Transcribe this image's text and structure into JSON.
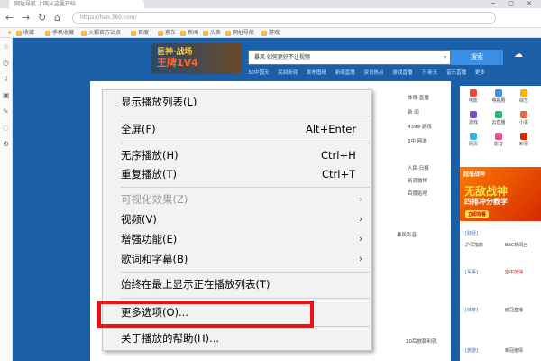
{
  "browser": {
    "tab_title": "网址导航 上网从这里开始",
    "url": "https://hao.360.com/",
    "bookmarks": [
      "收藏",
      "手机收藏",
      "火狐官方站点",
      "百度",
      "京东",
      "新闻",
      "头条",
      "网址导航",
      "游戏"
    ],
    "nav_buttons": [
      "←",
      "→",
      "↻",
      "⌂"
    ],
    "window_controls": "─ □ ✕"
  },
  "page": {
    "game_banner_line1": "巨神·战场",
    "game_banner_line2": "王牌1V4",
    "search_text": "暴风 如何更好不让视频",
    "search_button": "搜索",
    "hot_links": [
      "30中国天",
      "民间新闻",
      "发布图纸",
      "新闻直播",
      "资讯热点",
      "游戏直播",
      "下 新天",
      "音乐直播",
      "更多"
    ],
    "content_links_right": [
      "体育·直播",
      "新 闻",
      "4399·游戏",
      "3中 网游",
      "人民·日报",
      "新浪微博",
      "百度贴吧"
    ],
    "content_mid": "暴风影音",
    "content_bottom": "10后放款利就",
    "side_icons": [
      "电影",
      "电视剧",
      "综艺",
      "游戏",
      "云直播",
      "小说",
      "网页",
      "影音",
      "彩票"
    ],
    "ad_top": "超低战神",
    "ad_title": "无敌战神",
    "ad_sub": "四排冲分教学",
    "ad_btn": "立即观看",
    "right_list": [
      "[财经]",
      "沪深指数",
      "BBC新闻台",
      "[军事]",
      "空中加油",
      "[体育]",
      "欧冠直播",
      "[旅游]",
      "新冠疫情"
    ]
  },
  "context_menu": {
    "items": [
      {
        "label": "显示播放列表(L)",
        "shortcut": "",
        "submenu": false,
        "disabled": false
      },
      {
        "label": "全屏(F)",
        "shortcut": "Alt+Enter",
        "submenu": false,
        "disabled": false
      },
      {
        "label": "无序播放(H)",
        "shortcut": "Ctrl+H",
        "submenu": false,
        "disabled": false
      },
      {
        "label": "重复播放(T)",
        "shortcut": "Ctrl+T",
        "submenu": false,
        "disabled": false
      },
      {
        "label": "可视化效果(Z)",
        "shortcut": "",
        "submenu": true,
        "disabled": true
      },
      {
        "label": "视频(V)",
        "shortcut": "",
        "submenu": true,
        "disabled": false
      },
      {
        "label": "增强功能(E)",
        "shortcut": "",
        "submenu": true,
        "disabled": false
      },
      {
        "label": "歌词和字幕(B)",
        "shortcut": "",
        "submenu": true,
        "disabled": false
      },
      {
        "label": "始终在最上显示正在播放列表(T)",
        "shortcut": "",
        "submenu": false,
        "disabled": false
      },
      {
        "label": "更多选项(O)...",
        "shortcut": "",
        "submenu": false,
        "disabled": false
      },
      {
        "label": "关于播放的帮助(H)...",
        "shortcut": "",
        "submenu": false,
        "disabled": false
      }
    ],
    "highlight_color": "#ee1111"
  }
}
